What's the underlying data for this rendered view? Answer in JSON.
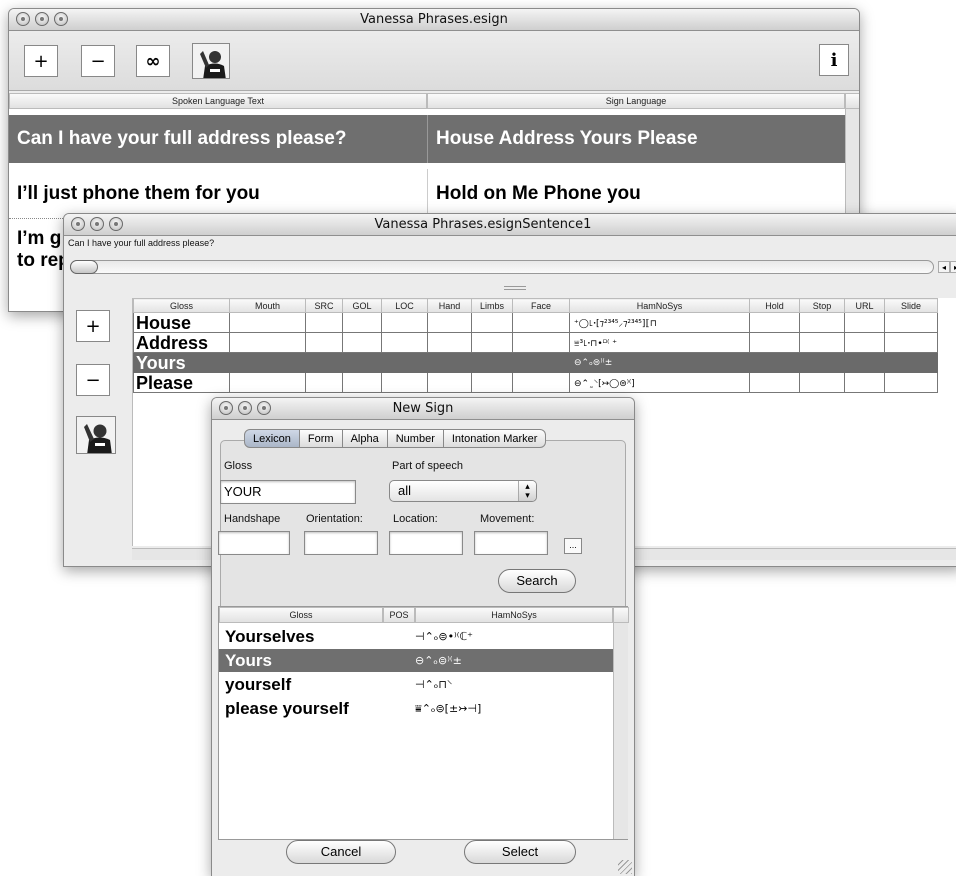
{
  "main_window": {
    "title": "Vanessa Phrases.esign",
    "toolbar": {
      "add_label": "+",
      "remove_label": "−",
      "loop_label": "∞",
      "info_label": "i"
    },
    "columns": [
      "Spoken Language Text",
      "Sign Language"
    ],
    "rows": [
      {
        "spoken": "Can I have your full address please?",
        "sign": "House Address Yours Please",
        "selected": true
      },
      {
        "spoken": "I’ll just phone them for you",
        "sign": "Hold on Me Phone you",
        "selected": false
      },
      {
        "spoken": "I’m g",
        "spoken2": "to rep",
        "sign": "",
        "selected": false
      }
    ]
  },
  "sentence_window": {
    "title": "Vanessa Phrases.esignSentence1",
    "sentence_text": "Can I have your full address please?",
    "add_label": "+",
    "remove_label": "−",
    "columns": [
      "Gloss",
      "Mouth",
      "SRC",
      "GOL",
      "LOC",
      "Hand",
      "Limbs",
      "Face",
      "HamNoSys",
      "Hold",
      "Stop",
      "URL",
      "Slide"
    ],
    "rows": [
      {
        "gloss": "House",
        "hamnosys": "⁺◯꜖ꞏ[⁊²³⁴⁵⸝⁊²³⁴⁵]⟦⊓",
        "selected": false
      },
      {
        "gloss": "Address",
        "hamnosys": "⩸³꜖ꞏ⊓•⸋⁽ ⁺",
        "selected": false
      },
      {
        "gloss": "Yours",
        "hamnosys": "⊖⌃ₒ⊜⁾⁽±",
        "selected": true
      },
      {
        "gloss": "Please",
        "hamnosys": "⊖⌃˷⸌[↣◯⊜⁾⁽]",
        "selected": false
      }
    ]
  },
  "new_sign_window": {
    "title": "New Sign",
    "tabs": [
      {
        "label": "Lexicon",
        "active": true
      },
      {
        "label": "Form",
        "active": false
      },
      {
        "label": "Alpha",
        "active": false
      },
      {
        "label": "Number",
        "active": false
      },
      {
        "label": "Intonation Marker",
        "active": false
      }
    ],
    "gloss_label": "Gloss",
    "gloss_value": "YOUR",
    "pos_label": "Part of speech",
    "pos_value": "all",
    "handshape_label": "Handshape",
    "orientation_label": "Orientation:",
    "location_label": "Location:",
    "movement_label": "Movement:",
    "more_label": "...",
    "search_label": "Search",
    "results_columns": [
      "Gloss",
      "POS",
      "HamNoSys"
    ],
    "results": [
      {
        "gloss": "Yourselves",
        "hamnosys": "⊣⌃ₒ⊜•⁾⁽ℂ⁺",
        "selected": false
      },
      {
        "gloss": "Yours",
        "hamnosys": "⊖⌃ₒ⊜⁾⁽±",
        "selected": true
      },
      {
        "gloss": "yourself",
        "hamnosys": "⊣⌃ₒ⊓⸌",
        "selected": false
      },
      {
        "gloss": "please yourself",
        "hamnosys": "⩸⌃ₒ⊜[±↣⊣]",
        "selected": false
      }
    ],
    "cancel_label": "Cancel",
    "select_label": "Select"
  }
}
